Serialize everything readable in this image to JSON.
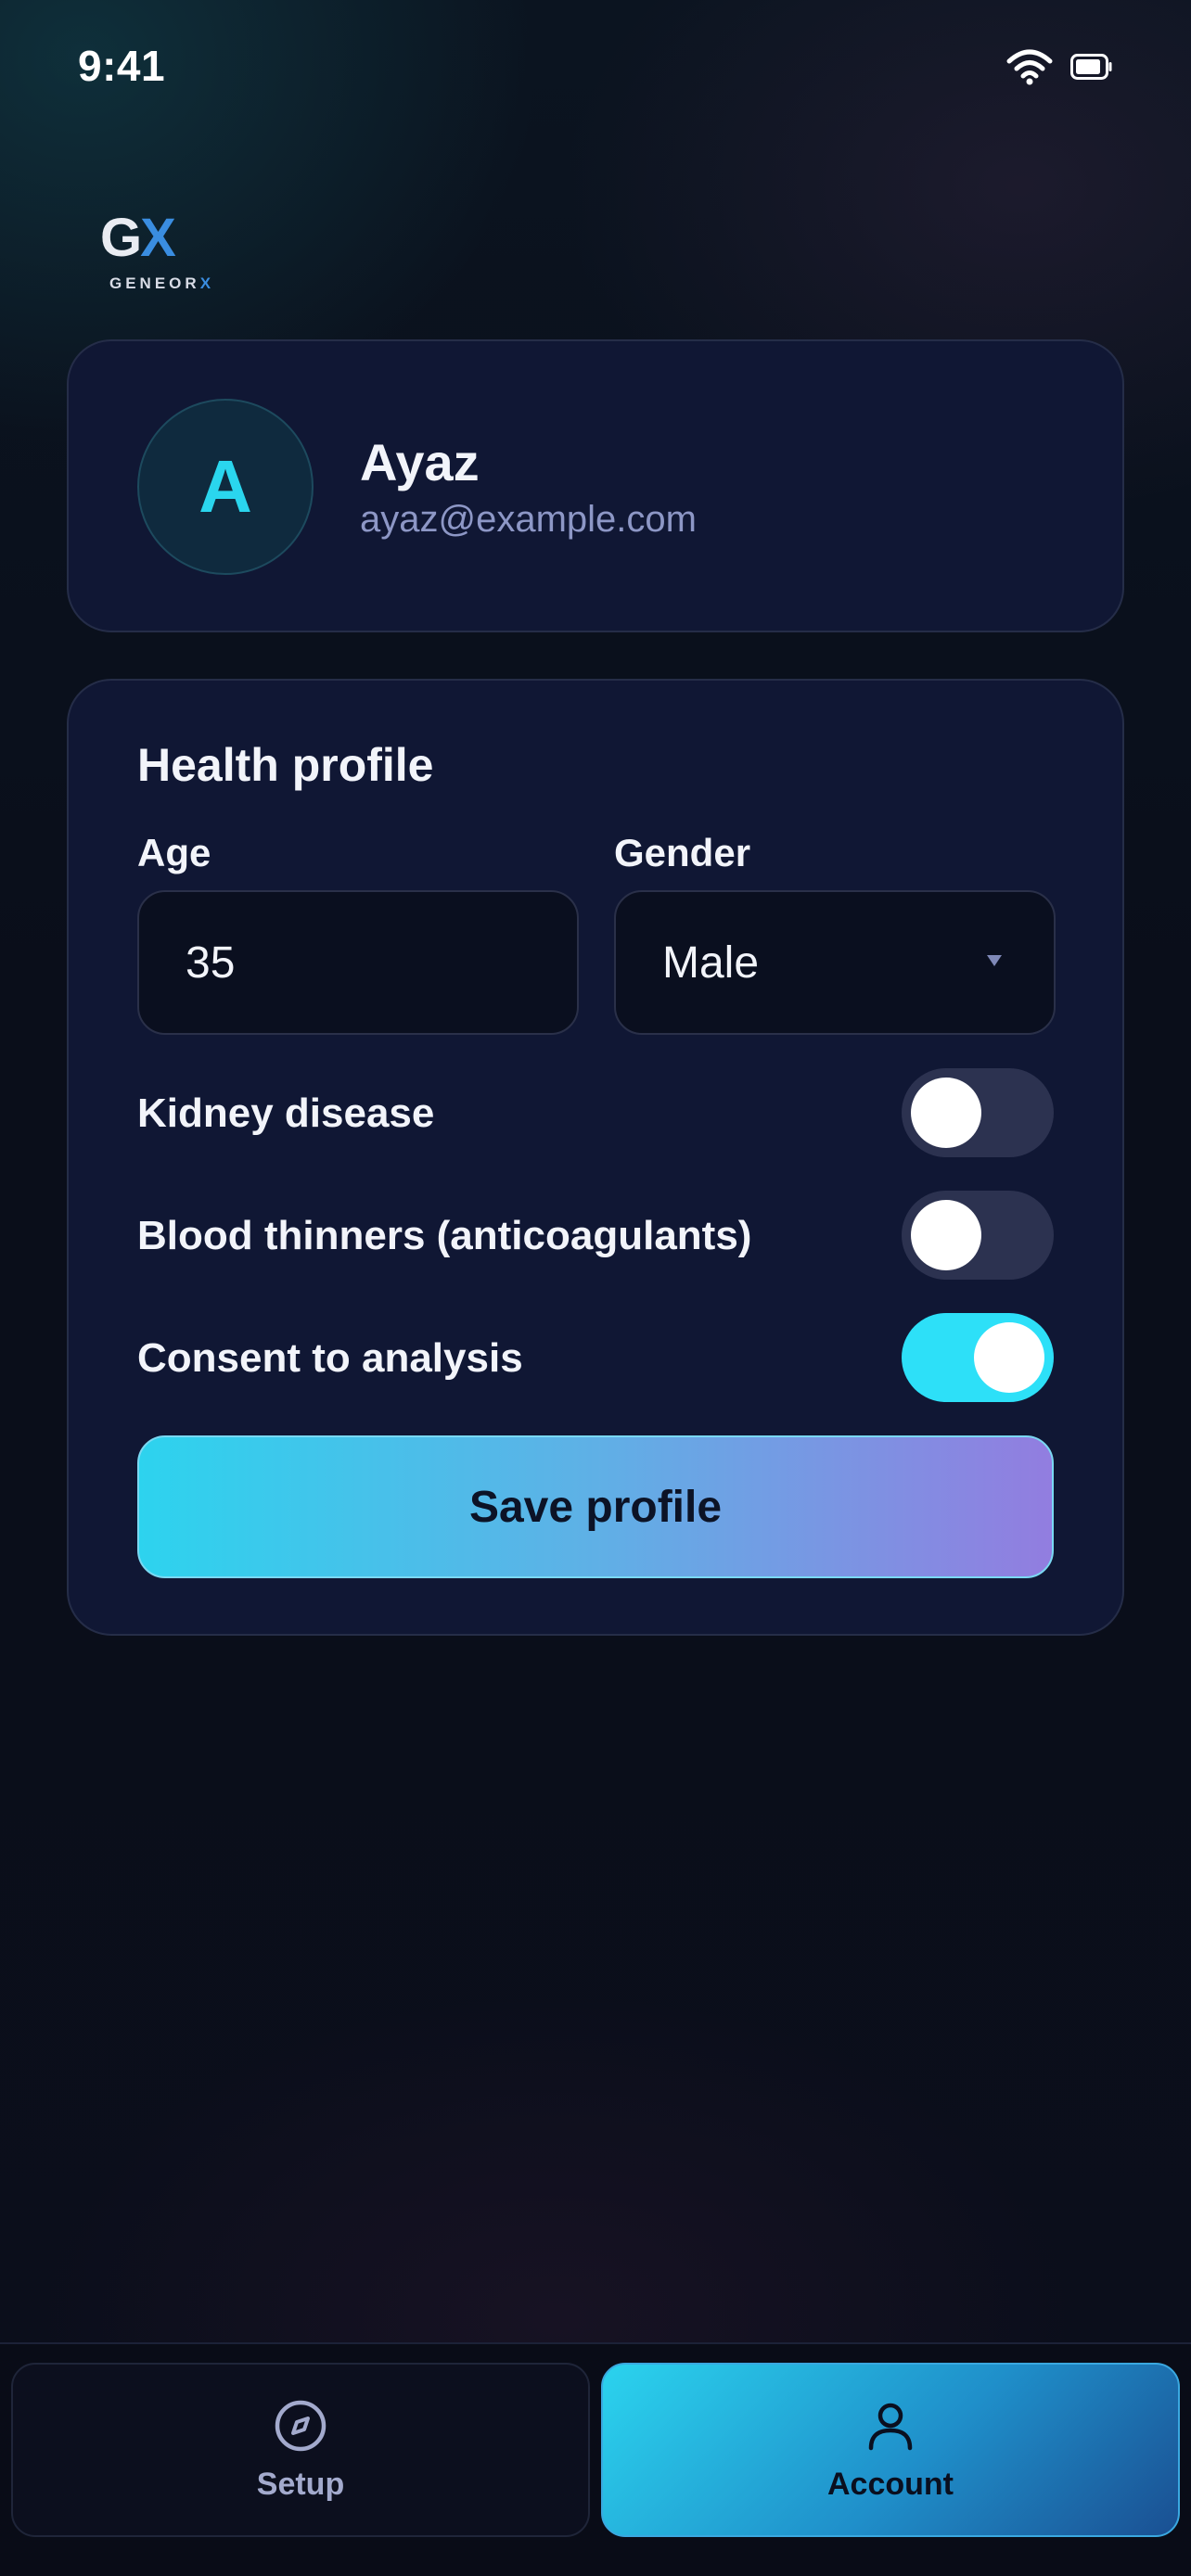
{
  "status_bar": {
    "time": "9:41"
  },
  "logo": {
    "mark_g": "G",
    "mark_x": "X",
    "word": "GENEOR",
    "word_x": "X"
  },
  "profile": {
    "initial": "A",
    "name": "Ayaz",
    "email": "ayaz@example.com"
  },
  "health_profile": {
    "title": "Health profile",
    "age_label": "Age",
    "age_value": "35",
    "gender_label": "Gender",
    "gender_value": "Male",
    "toggles": [
      {
        "label": "Kidney disease",
        "on": false
      },
      {
        "label": "Blood thinners (anticoagulants)",
        "on": false
      },
      {
        "label": "Consent to analysis",
        "on": true
      }
    ],
    "save_label": "Save profile"
  },
  "tabs": [
    {
      "label": "Setup",
      "icon": "compass-icon",
      "active": false
    },
    {
      "label": "Account",
      "icon": "user-icon",
      "active": true
    }
  ],
  "colors": {
    "accent_cyan": "#2de0f8",
    "card_bg": "#101734",
    "email_text": "#8d97c6"
  }
}
